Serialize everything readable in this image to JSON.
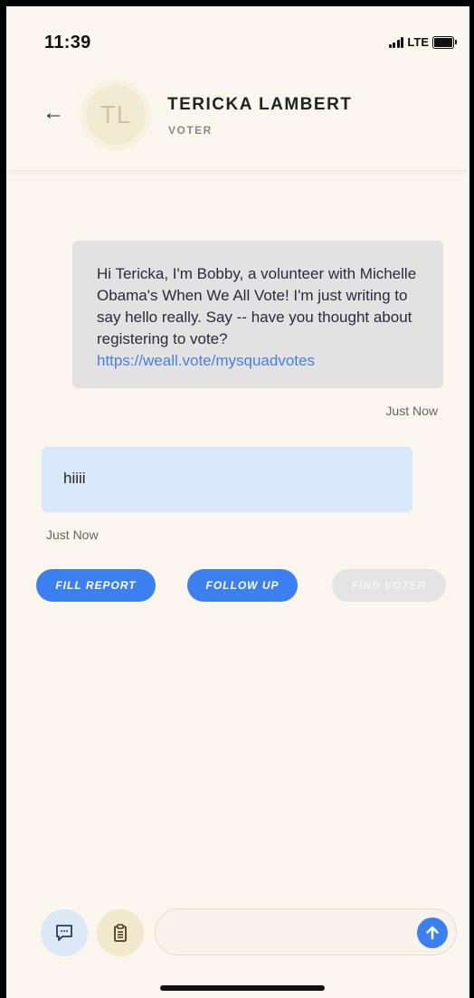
{
  "status_bar": {
    "time": "11:39",
    "network": "LTE"
  },
  "header": {
    "back_icon": "arrow-left-icon",
    "avatar_initials": "TL",
    "contact_name": "TERICKA LAMBERT",
    "contact_role": "VOTER"
  },
  "messages": [
    {
      "direction": "outgoing",
      "text": "Hi Tericka, I'm Bobby, a volunteer with Michelle Obama's When We All Vote! I'm just writing to say hello really. Say -- have you thought about registering to vote?",
      "link": "https://weall.vote/mysquadvotes",
      "time": "Just Now"
    },
    {
      "direction": "incoming",
      "text": "hiiii",
      "time": "Just Now"
    }
  ],
  "actions": {
    "fill_report": "FILL REPORT",
    "follow_up": "FOLLOW UP",
    "find_voter": "FIND VOTER"
  },
  "composer": {
    "placeholder": "",
    "chat_icon": "chat-bubble-icon",
    "clipboard_icon": "clipboard-icon",
    "send_icon": "arrow-up-icon"
  },
  "colors": {
    "background": "#faf6ee",
    "accent": "#3c7ff0",
    "outgoing_bubble": "#e2e2e2",
    "incoming_bubble": "#d9e8fb",
    "avatar_bg": "#f3ead2"
  }
}
